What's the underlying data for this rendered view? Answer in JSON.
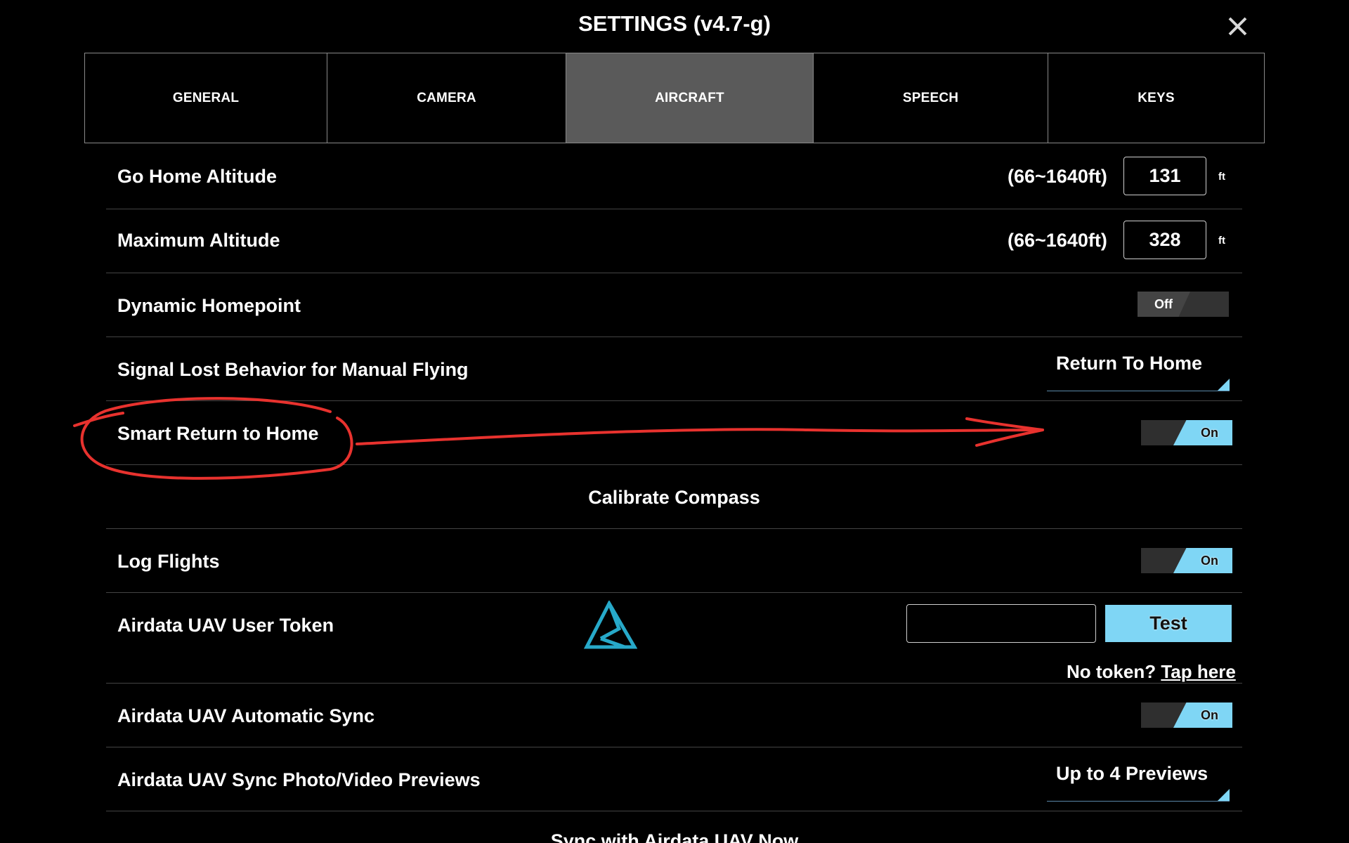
{
  "header": {
    "title": "SETTINGS (v4.7-g)",
    "close_icon": "close-icon"
  },
  "tabs": [
    {
      "label": "GENERAL",
      "active": false
    },
    {
      "label": "CAMERA",
      "active": false
    },
    {
      "label": "AIRCRAFT",
      "active": true
    },
    {
      "label": "SPEECH",
      "active": false
    },
    {
      "label": "KEYS",
      "active": false
    }
  ],
  "settings": {
    "go_home_altitude": {
      "label": "Go Home Altitude",
      "range": "(66~1640ft)",
      "value": "131",
      "unit": "ft"
    },
    "maximum_altitude": {
      "label": "Maximum Altitude",
      "range": "(66~1640ft)",
      "value": "328",
      "unit": "ft"
    },
    "dynamic_homepoint": {
      "label": "Dynamic Homepoint",
      "state": "Off"
    },
    "signal_lost_behavior": {
      "label": "Signal Lost Behavior for Manual Flying",
      "value": "Return To Home"
    },
    "smart_return_to_home": {
      "label": "Smart Return to Home",
      "state": "On"
    },
    "calibrate_compass": {
      "label": "Calibrate Compass"
    },
    "log_flights": {
      "label": "Log Flights",
      "state": "On"
    },
    "airdata_token": {
      "label": "Airdata UAV User Token",
      "logo_icon": "airdata-logo-icon",
      "token_value": "",
      "test_label": "Test",
      "no_token_text": "No token?",
      "tap_here_text": "Tap here"
    },
    "airdata_auto_sync": {
      "label": "Airdata UAV Automatic Sync",
      "state": "On"
    },
    "airdata_previews": {
      "label": "Airdata UAV Sync Photo/Video Previews",
      "value": "Up to 4 Previews"
    },
    "sync_now": {
      "label": "Sync with Airdata UAV Now"
    }
  },
  "colors": {
    "accent": "#7fd6f5",
    "active_tab": "#5a5a5a",
    "annotation_red": "#e8322e",
    "logo": "#27a9c9"
  }
}
